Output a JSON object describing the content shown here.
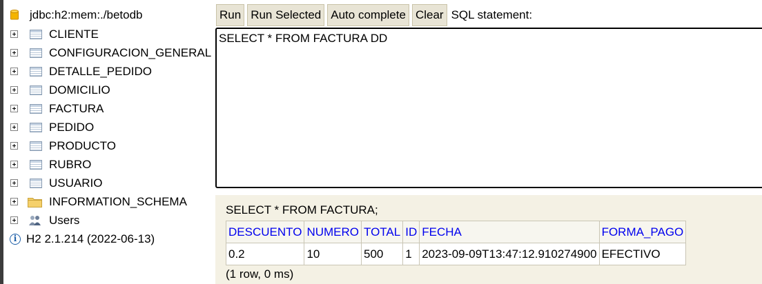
{
  "tree": {
    "connection": "jdbc:h2:mem:./betodb",
    "tables": [
      "CLIENTE",
      "CONFIGURACION_GENERAL",
      "DETALLE_PEDIDO",
      "DOMICILIO",
      "FACTURA",
      "PEDIDO",
      "PRODUCTO",
      "RUBRO",
      "USUARIO"
    ],
    "schema": "INFORMATION_SCHEMA",
    "users": "Users",
    "version": "H2 2.1.214 (2022-06-13)"
  },
  "toolbar": {
    "run": "Run",
    "run_selected": "Run Selected",
    "auto_complete": "Auto complete",
    "clear": "Clear",
    "sql_label": "SQL statement:"
  },
  "editor": {
    "text": "SELECT * FROM FACTURA DD"
  },
  "result": {
    "query": "SELECT * FROM FACTURA;",
    "columns": [
      "DESCUENTO",
      "NUMERO",
      "TOTAL",
      "ID",
      "FECHA",
      "FORMA_PAGO"
    ],
    "rows": [
      [
        "0.2",
        "10",
        "500",
        "1",
        "2023-09-09T13:47:12.910274900",
        "EFECTIVO"
      ]
    ],
    "footer": "(1 row, 0 ms)"
  }
}
